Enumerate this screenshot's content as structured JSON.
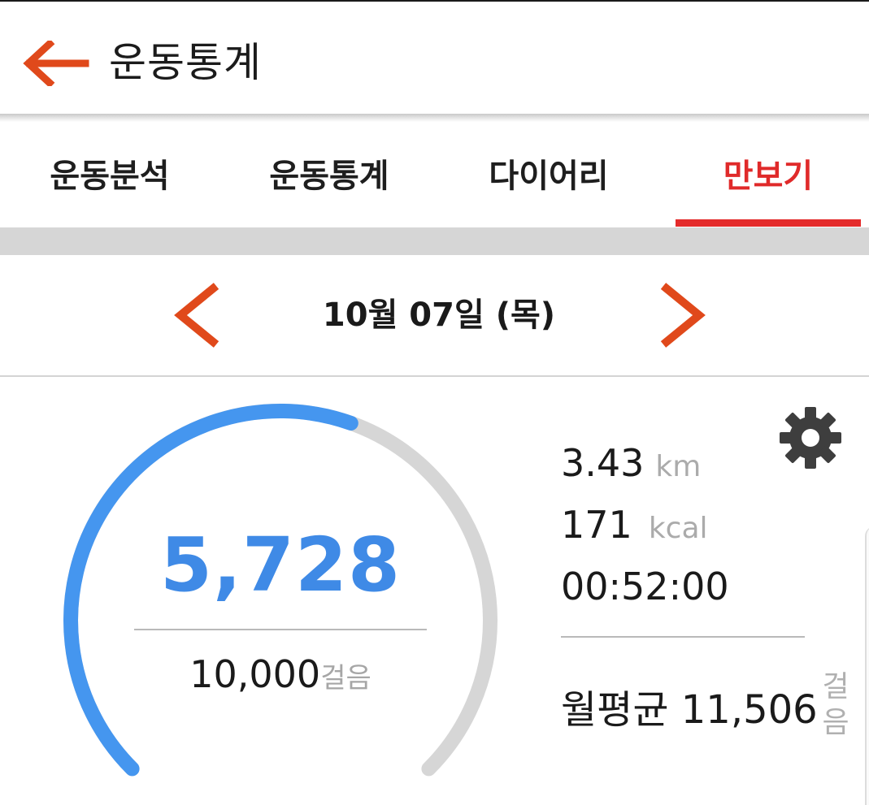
{
  "app": {
    "title": "운동통계",
    "back_icon": "arrow-left-icon"
  },
  "colors": {
    "accent": "#e0491b",
    "tab_active": "#e02a2a",
    "progress": "#3f8ae6",
    "track": "#d6d6d6"
  },
  "tabs": [
    {
      "label": "운동분석",
      "active": false
    },
    {
      "label": "운동통계",
      "active": false
    },
    {
      "label": "다이어리",
      "active": false
    },
    {
      "label": "만보기",
      "active": true
    }
  ],
  "date_nav": {
    "date": "10월 07일 (목)",
    "prev_icon": "chevron-left-icon",
    "next_icon": "chevron-right-icon"
  },
  "pedometer": {
    "steps": "5,728",
    "goal": "10,000",
    "goal_unit": "걸음",
    "progress_fraction": 0.5728,
    "settings_icon": "gear-icon"
  },
  "stats": {
    "distance": {
      "value": "3.43",
      "unit": "km"
    },
    "calories": {
      "value": "171",
      "unit": "kcal"
    },
    "duration": "00:52:00"
  },
  "monthly": {
    "label": "월평균 11,506",
    "unit_line1": "걸",
    "unit_line2": "음"
  }
}
